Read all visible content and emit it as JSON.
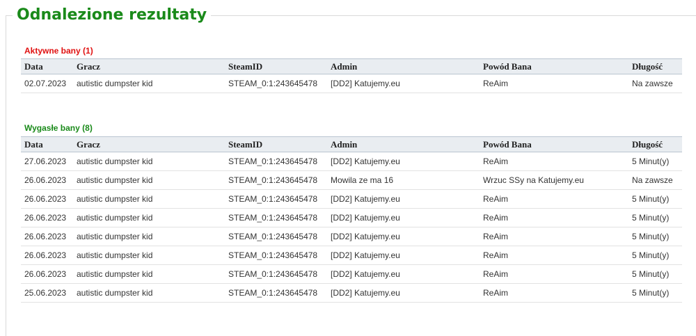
{
  "page": {
    "title": "Odnalezione rezultaty"
  },
  "columns": [
    "Data",
    "Gracz",
    "SteamID",
    "Admin",
    "Powód Bana",
    "Długość"
  ],
  "active_bans": {
    "title": "Aktywne bany (1)",
    "color": "#e01010",
    "rows": [
      [
        "02.07.2023",
        "autistic dumpster kid",
        "STEAM_0:1:243645478",
        "[DD2] Katujemy.eu",
        "ReAim",
        "Na zawsze"
      ]
    ]
  },
  "expired_bans": {
    "title": "Wygasłe bany (8)",
    "color": "#1a8a1a",
    "rows": [
      [
        "27.06.2023",
        "autistic dumpster kid",
        "STEAM_0:1:243645478",
        "[DD2] Katujemy.eu",
        "ReAim",
        "5 Minut(y)"
      ],
      [
        "26.06.2023",
        "autistic dumpster kid",
        "STEAM_0:1:243645478",
        "Mowila ze ma 16",
        "Wrzuc SSy na Katujemy.eu",
        "Na zawsze"
      ],
      [
        "26.06.2023",
        "autistic dumpster kid",
        "STEAM_0:1:243645478",
        "[DD2] Katujemy.eu",
        "ReAim",
        "5 Minut(y)"
      ],
      [
        "26.06.2023",
        "autistic dumpster kid",
        "STEAM_0:1:243645478",
        "[DD2] Katujemy.eu",
        "ReAim",
        "5 Minut(y)"
      ],
      [
        "26.06.2023",
        "autistic dumpster kid",
        "STEAM_0:1:243645478",
        "[DD2] Katujemy.eu",
        "ReAim",
        "5 Minut(y)"
      ],
      [
        "26.06.2023",
        "autistic dumpster kid",
        "STEAM_0:1:243645478",
        "[DD2] Katujemy.eu",
        "ReAim",
        "5 Minut(y)"
      ],
      [
        "26.06.2023",
        "autistic dumpster kid",
        "STEAM_0:1:243645478",
        "[DD2] Katujemy.eu",
        "ReAim",
        "5 Minut(y)"
      ],
      [
        "25.06.2023",
        "autistic dumpster kid",
        "STEAM_0:1:243645478",
        "[DD2] Katujemy.eu",
        "ReAim",
        "5 Minut(y)"
      ]
    ]
  }
}
